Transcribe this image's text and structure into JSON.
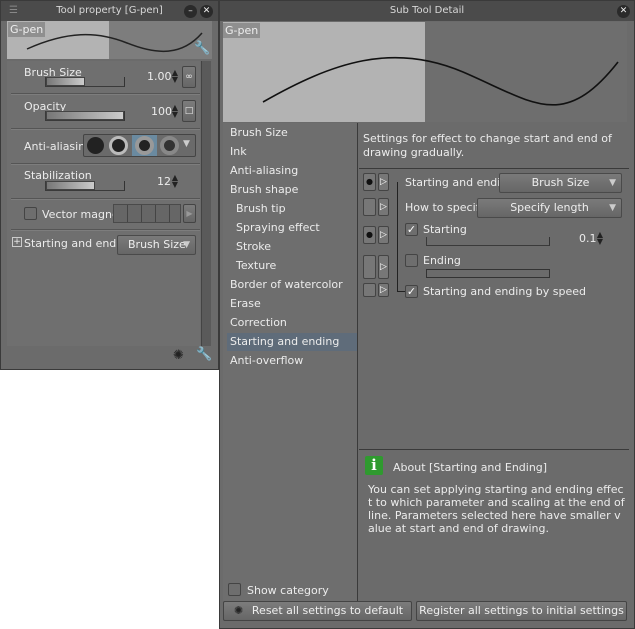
{
  "tool_property": {
    "title": "Tool property [G-pen]",
    "preview_label": "G-pen",
    "brush_size": {
      "label": "Brush Size",
      "value": "1.00",
      "fill": 0.5
    },
    "opacity": {
      "label": "Opacity",
      "value": "100",
      "fill": 1.0
    },
    "anti_aliasing": {
      "label": "Anti-aliasing",
      "selected_index": 2
    },
    "stabilization": {
      "label": "Stabilization",
      "value": "12",
      "fill": 0.63
    },
    "vector_magnet": {
      "label": "Vector magnet",
      "checked": false
    },
    "starting_and_ending": {
      "label": "Starting and ending",
      "value": "Brush Size"
    }
  },
  "sub_tool_detail": {
    "title": "Sub Tool Detail",
    "preview_label": "G-pen",
    "categories": [
      "Brush Size",
      "Ink",
      "Anti-aliasing",
      "Brush shape",
      "Brush tip",
      "Spraying effect",
      "Stroke",
      "Texture",
      "Border of watercolor",
      "Erase",
      "Correction",
      "Starting and ending",
      "Anti-overflow"
    ],
    "selected_category": "Starting and ending",
    "show_category": "Show category",
    "description": "Settings for effect to change start and end of drawing gradually.",
    "settings": {
      "starting_and_ending": {
        "label": "Starting and ending",
        "value": "Brush Size"
      },
      "how_to_specify": {
        "label": "How to specify",
        "value": "Specify length"
      },
      "starting": {
        "label": "Starting",
        "checked": true,
        "value": "0.1"
      },
      "ending": {
        "label": "Ending",
        "checked": false
      },
      "by_speed": {
        "label": "Starting and ending by speed",
        "checked": true
      }
    },
    "about": {
      "title": "About [Starting and Ending]",
      "text": "You can set applying starting and ending effect to which parameter and scaling at the end of line. Parameters selected here have smaller value at start and end of drawing."
    },
    "reset_button": "Reset all settings to default",
    "register_button": "Register all settings to initial settings"
  }
}
